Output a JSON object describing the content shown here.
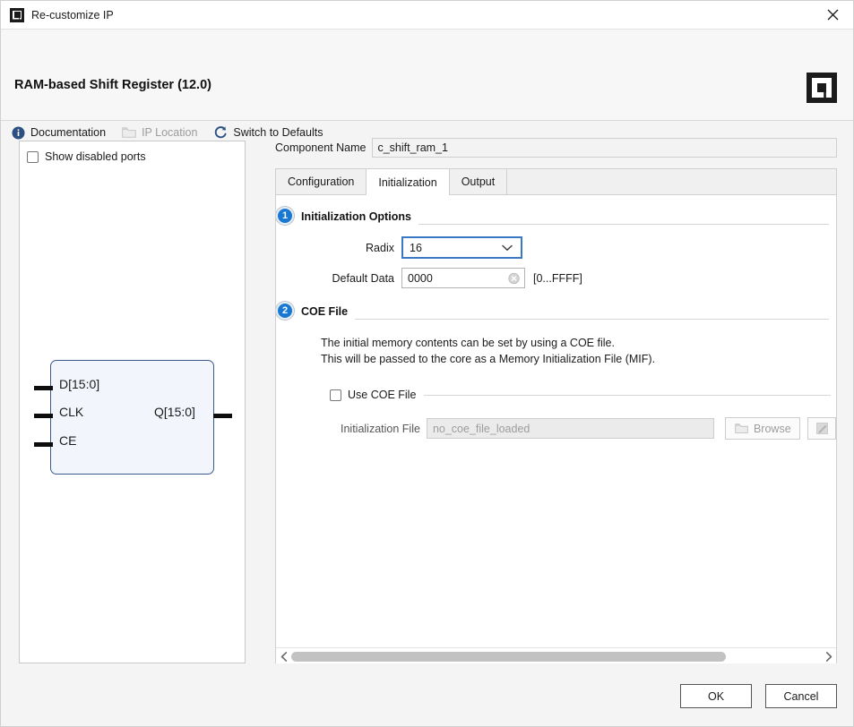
{
  "window": {
    "title": "Re-customize IP",
    "icon": "xilinx-logo-icon",
    "close_label": "✕"
  },
  "header": {
    "ip_title": "RAM-based Shift Register (12.0)",
    "brand_icon": "amd-xilinx-logo-icon",
    "toolbar": [
      {
        "label": "Documentation",
        "icon": "info-icon",
        "disabled": false
      },
      {
        "label": "IP Location",
        "icon": "folder-icon",
        "disabled": true
      },
      {
        "label": "Switch to Defaults",
        "icon": "refresh-icon",
        "disabled": false
      }
    ]
  },
  "ip_panel": {
    "show_disabled_ports": {
      "label": "Show disabled ports",
      "checked": false
    },
    "symbol": {
      "inputs": [
        "D[15:0]",
        "CLK",
        "CE"
      ],
      "outputs": [
        "Q[15:0]"
      ]
    }
  },
  "config": {
    "component_name_label": "Component Name",
    "component_name_value": "c_shift_ram_1",
    "tabs": [
      {
        "label": "Configuration",
        "active": false
      },
      {
        "label": "Initialization",
        "active": true
      },
      {
        "label": "Output",
        "active": false
      }
    ],
    "initialization_options": {
      "step": "1",
      "title": "Initialization Options",
      "radix_label": "Radix",
      "radix_value": "16",
      "default_data_label": "Default Data",
      "default_data_value": "0000",
      "range_hint": "[0...FFFF]"
    },
    "coe_file": {
      "step": "2",
      "title": "COE File",
      "description_line1": "The initial memory contents can be set by using a COE file.",
      "description_line2": "This will be passed to the core as a Memory Initialization File (MIF).",
      "use_coe_label": "Use COE File",
      "use_coe_checked": false,
      "init_file_label": "Initialization File",
      "init_file_placeholder": "no_coe_file_loaded",
      "browse_label": "Browse",
      "browse_icon": "folder-open-icon",
      "edit_icon": "edit-file-icon"
    },
    "scrollbar": {
      "left_icon": "chevron-left-icon",
      "right_icon": "chevron-right-icon"
    }
  },
  "footer": {
    "ok_label": "OK",
    "cancel_label": "Cancel"
  },
  "colors": {
    "accent_blue": "#1878d2",
    "focus_border": "#3b78c3",
    "symbol_border": "#3a5a8c",
    "symbol_fill": "#f2f6fc"
  }
}
